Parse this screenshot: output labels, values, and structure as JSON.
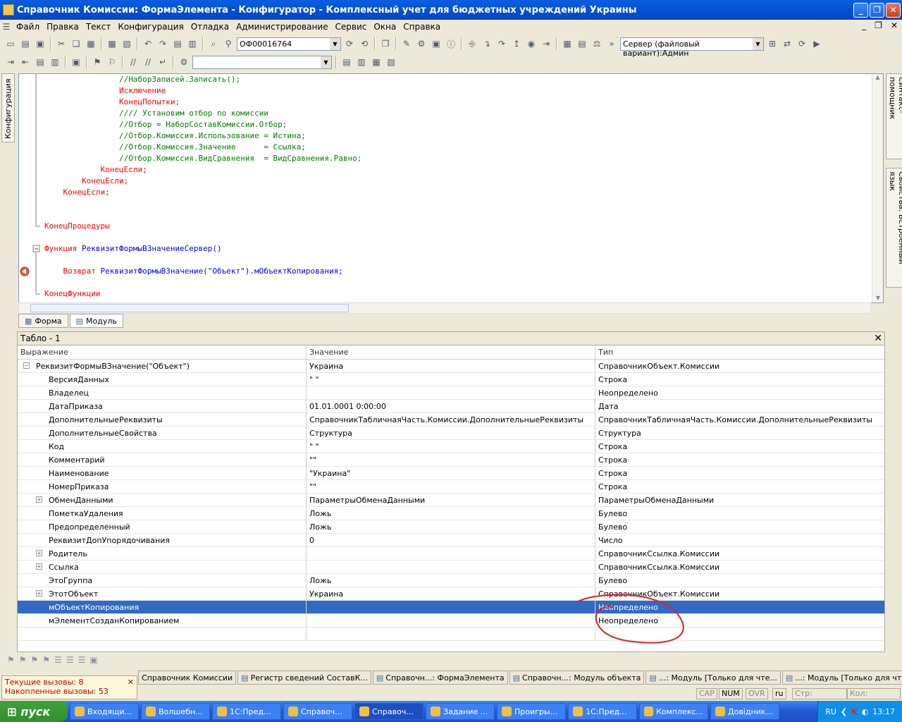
{
  "window": {
    "title": "Справочник Комиссии: ФормаЭлемента - Конфигуратор - Комплексный учет для бюджетных учреждений Украины"
  },
  "menu": [
    "Файл",
    "Правка",
    "Текст",
    "Конфигурация",
    "Отладка",
    "Администрирование",
    "Сервис",
    "Окна",
    "Справка"
  ],
  "toolbar": {
    "search_value": "ОФ00016764",
    "server_value": "Сервер (файловый вариант):Админ"
  },
  "side": {
    "left_tab": "Конфигурация",
    "right_tab1": "Синтакс-помощник",
    "right_tab2": "Свойства: Встроенный язык"
  },
  "code_lines": [
    {
      "indent": "                ",
      "text": "//НаборЗаписей.Записать();",
      "cls": "cm"
    },
    {
      "indent": "                ",
      "text": "Исключение",
      "cls": "kw"
    },
    {
      "indent": "                ",
      "text": "КонецПопытки;",
      "cls": "kw"
    },
    {
      "indent": "                ",
      "text": "//// Установим отбор по комиссии",
      "cls": "cm"
    },
    {
      "indent": "                ",
      "text": "//Отбор = НаборСоставКомиссии.Отбор;",
      "cls": "cm"
    },
    {
      "indent": "                ",
      "text": "//Отбор.Комиссия.Использование = Истина;",
      "cls": "cm"
    },
    {
      "indent": "                ",
      "text": "//Отбор.Комиссия.Значение      = Ссылка;",
      "cls": "cm"
    },
    {
      "indent": "                ",
      "text": "//Отбор.Комиссия.ВидСравнения  = ВидСравнения.Равно;",
      "cls": "cm"
    },
    {
      "indent": "            ",
      "text": "КонецЕсли;",
      "cls": "kw"
    },
    {
      "indent": "        ",
      "text": "КонецЕсли;",
      "cls": "kw"
    },
    {
      "indent": "    ",
      "text": "КонецЕсли;",
      "cls": "kw"
    },
    {
      "indent": "",
      "text": "",
      "cls": "st"
    },
    {
      "indent": "",
      "text": "",
      "cls": "st"
    },
    {
      "indent": "",
      "text": "КонецПроцедуры",
      "cls": "kw"
    },
    {
      "indent": "",
      "text": "",
      "cls": "st"
    },
    {
      "indent": "",
      "text": "Функция ",
      "cls": "kw",
      "text2": "РеквизитФормыВЗначениеСервер()",
      "cls2": "fn"
    },
    {
      "indent": "",
      "text": "",
      "cls": "st"
    },
    {
      "indent": "    ",
      "text": "Возврат ",
      "cls": "kw",
      "text2": "РеквизитФормыВЗначение(\"Объект\").мОбъектКопирования;",
      "cls2": "fn"
    },
    {
      "indent": "",
      "text": "",
      "cls": "st"
    },
    {
      "indent": "",
      "text": "КонецФункции",
      "cls": "kw"
    }
  ],
  "form_tabs": [
    "Форма",
    "Модуль"
  ],
  "panel": {
    "title": "Табло - 1",
    "cols": [
      "Выражение",
      "Значение",
      "Тип"
    ],
    "rows": [
      {
        "expr": "РеквизитФормыВЗначение(\"Объект\")",
        "val": "Украина",
        "type": "СправочникОбъект.Комиссии",
        "level": 0,
        "toggle": "−"
      },
      {
        "expr": "ВерсияДанных",
        "val": "\"         \"",
        "type": "Строка",
        "level": 1,
        "toggle": ""
      },
      {
        "expr": "Владелец",
        "val": "",
        "type": "Неопределено",
        "level": 1,
        "toggle": ""
      },
      {
        "expr": "ДатаПриказа",
        "val": "01.01.0001 0:00:00",
        "type": "Дата",
        "level": 1,
        "toggle": ""
      },
      {
        "expr": "ДополнительныеРеквизиты",
        "val": "СправочникТабличнаяЧасть.Комиссии.ДополнительныеРеквизиты",
        "type": "СправочникТабличнаяЧасть.Комиссии.ДополнительныеРеквизиты",
        "level": 1,
        "toggle": ""
      },
      {
        "expr": "ДополнительныеСвойства",
        "val": "Структура",
        "type": "Структура",
        "level": 1,
        "toggle": ""
      },
      {
        "expr": "Код",
        "val": "\"       \"",
        "type": "Строка",
        "level": 1,
        "toggle": ""
      },
      {
        "expr": "Комментарий",
        "val": "\"\"",
        "type": "Строка",
        "level": 1,
        "toggle": ""
      },
      {
        "expr": "Наименование",
        "val": "\"Украина\"",
        "type": "Строка",
        "level": 1,
        "toggle": ""
      },
      {
        "expr": "НомерПриказа",
        "val": "\"\"",
        "type": "Строка",
        "level": 1,
        "toggle": ""
      },
      {
        "expr": "ОбменДанными",
        "val": "ПараметрыОбменаДанными",
        "type": "ПараметрыОбменаДанными",
        "level": 1,
        "toggle": "+"
      },
      {
        "expr": "ПометкаУдаления",
        "val": "Ложь",
        "type": "Булево",
        "level": 1,
        "toggle": ""
      },
      {
        "expr": "Предопределенный",
        "val": "Ложь",
        "type": "Булево",
        "level": 1,
        "toggle": ""
      },
      {
        "expr": "РеквизитДопУпорядочивания",
        "val": "0",
        "type": "Число",
        "level": 1,
        "toggle": ""
      },
      {
        "expr": "Родитель",
        "val": "",
        "type": "СправочникСсылка.Комиссии",
        "level": 1,
        "toggle": "+"
      },
      {
        "expr": "Ссылка",
        "val": "",
        "type": "СправочникСсылка.Комиссии",
        "level": 1,
        "toggle": "+"
      },
      {
        "expr": "ЭтоГруппа",
        "val": "Ложь",
        "type": "Булево",
        "level": 1,
        "toggle": ""
      },
      {
        "expr": "ЭтотОбъект",
        "val": "Украина",
        "type": "СправочникОбъект.Комиссии",
        "level": 1,
        "toggle": "+"
      },
      {
        "expr": "мОбъектКопирования",
        "val": "",
        "type": "Неопределено",
        "level": 1,
        "toggle": "",
        "selected": true
      },
      {
        "expr": "мЭлементСозданКопированием",
        "val": "",
        "type": "Неопределено",
        "level": 1,
        "toggle": ""
      }
    ]
  },
  "window_tabs": [
    "Справочник Комиссии",
    "Регистр сведений СоставК...",
    "Справочн...: ФормаЭлемента",
    "Справочн...: Модуль объекта",
    "...: Модуль [Только для чте...",
    "...: Модуль [Только для чте..."
  ],
  "calls": {
    "current": "Текущие вызовы: 8",
    "accumulated": "Накопленные вызовы: 53"
  },
  "status": {
    "cap": "CAP",
    "num": "NUM",
    "ovr": "OVR",
    "lang": "ru",
    "str": "Стр:",
    "col": "Кол:"
  },
  "taskbar": {
    "start": "пуск",
    "tasks": [
      "Входящи...",
      "Волшебн...",
      "1С:Пред...",
      "Справоч...",
      "Справоч...",
      "Задание ...",
      "Проигры...",
      "1С:Пред...",
      "Комплекс...",
      "Довідник..."
    ],
    "lang": "RU",
    "time": "13:17"
  }
}
